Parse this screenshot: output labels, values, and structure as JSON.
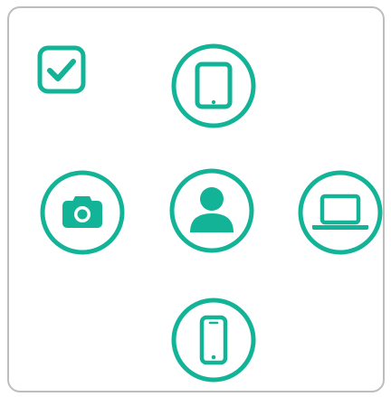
{
  "colors": {
    "accent": "#12b396",
    "frame": "#bdbdbd",
    "background": "#ffffff"
  },
  "checkbox": {
    "checked": true,
    "icon": "check-icon"
  },
  "devices": [
    {
      "id": "tablet",
      "icon": "tablet-icon"
    },
    {
      "id": "camera",
      "icon": "camera-icon"
    },
    {
      "id": "user",
      "icon": "user-icon"
    },
    {
      "id": "laptop",
      "icon": "laptop-icon"
    },
    {
      "id": "phone",
      "icon": "phone-icon"
    }
  ]
}
